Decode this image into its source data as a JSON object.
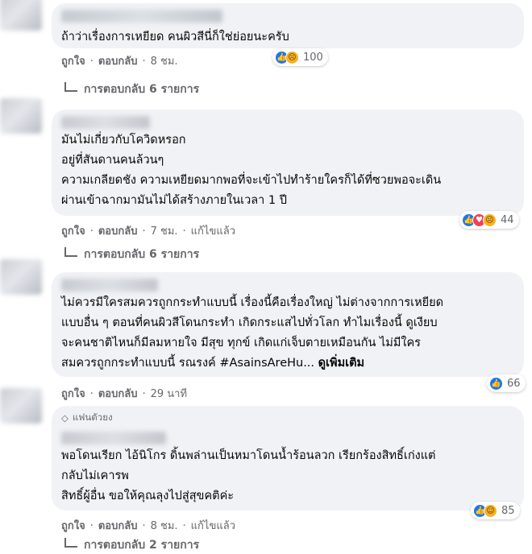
{
  "colors": {
    "bubble_bg": "#f0f2f5",
    "secondary_text": "#65676b",
    "like_blue": "#1877f2",
    "reaction_yellow": "#f7b125",
    "love_red": "#f33e58"
  },
  "labels": {
    "like": "ถูกใจ",
    "reply": "ตอบกลับ",
    "dot": "·",
    "edited": "แก้ไขแล้ว"
  },
  "comments": [
    {
      "lines": [
        "ถ้าว่าเรื่องการเหยียด คนผิวสีนี่ก็ใช่ย่อยนะครับ"
      ],
      "time": "8 ชม.",
      "reactions": [
        "like-icon",
        "sad-icon"
      ],
      "reaction_count": "100",
      "replies": "การตอบกลับ 6 รายการ"
    },
    {
      "lines": [
        "มันไม่เกี่ยวกับโควิดหรอก",
        "อยู่ที่สันดานคนล้วนๆ",
        "ความเกลียดชัง ความเหยียดมากพอที่จะเข้าไปทำร้ายใครก็ได้ที่ซวยพอจะเดิน",
        "ผ่านเข้าฉากมามันไม่ได้สร้างภายในเวลา 1 ปี"
      ],
      "time": "7 ชม.",
      "edited": true,
      "reactions": [
        "like-icon",
        "love-icon",
        "sad-icon"
      ],
      "reaction_count": "44",
      "replies": "การตอบกลับ 6 รายการ"
    },
    {
      "lines": [
        "ไม่ควรมีใครสมควรถูกกระทำแบบนี้ เรื่องนี้คือเรื่องใหญ่ ไม่ต่างจากการเหยียด",
        "แบบอื่น ๆ ตอนที่คนผิวสีโดนกระทำ เกิดกระแสไปทั่วโลก ทำไมเรื่องนี้ ดูเงียบ",
        "จะคนชาติไหนก็มีลมหายใจ มีสุข ทุกข์ เกิดแก่เจ็บตายเหมือนกัน ไม่มีใคร",
        "สมควรถูกกระทำแบบนี้ รณรงค์ #AsainsAreHu..."
      ],
      "see_more": "ดูเพิ่มเติม",
      "time": "29 นาที",
      "reactions": [
        "like-icon"
      ],
      "reaction_count": "66"
    },
    {
      "badge": "แฟนตัวยง",
      "lines": [
        "พอโดนเรียก ไอ้นิโกร ดิ้นพล่านเป็นหมาโดนน้ำร้อนลวก เรียกร้องสิทธิ์เก่งแต่",
        "กลับไม่เคารพ",
        "สิทธิ์ผู้อื่น ขอให้คุณลุงไปสู่สุขคติค่ะ"
      ],
      "time": "8 ชม.",
      "edited": true,
      "reactions": [
        "like-icon",
        "haha-icon"
      ],
      "reaction_count": "85",
      "replies": "การตอบกลับ 2 รายการ"
    }
  ]
}
